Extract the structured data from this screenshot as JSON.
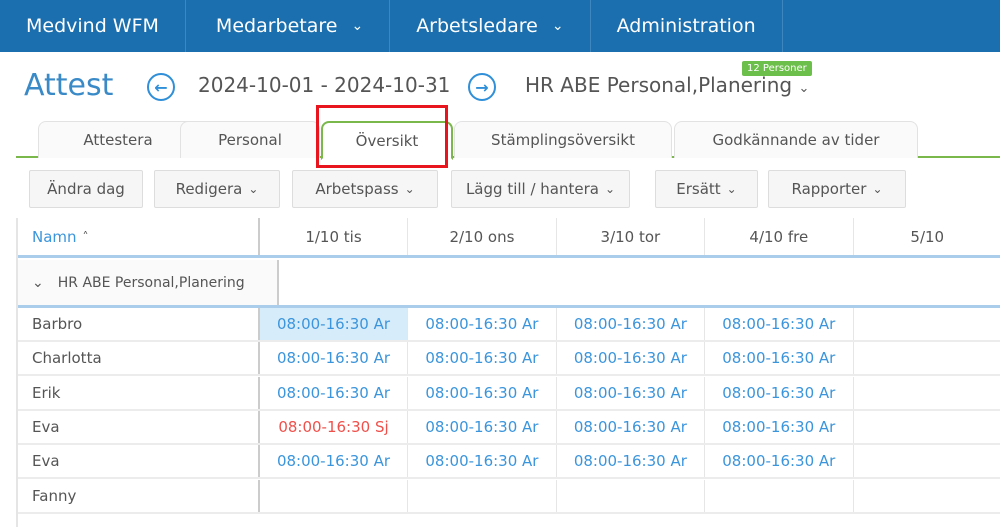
{
  "nav": {
    "items": [
      {
        "label": "Medvind WFM",
        "chevron": false
      },
      {
        "label": "Medarbetare",
        "chevron": true
      },
      {
        "label": "Arbetsledare",
        "chevron": true
      },
      {
        "label": "Administration",
        "chevron": false
      }
    ]
  },
  "header": {
    "title": "Attest",
    "date_range": "2024-10-01 - 2024-10-31",
    "group": "HR ABE Personal,Planering",
    "badge": "12 Personer"
  },
  "tabs": [
    {
      "label": "Attestera"
    },
    {
      "label": "Personal"
    },
    {
      "label": "Översikt",
      "active": true
    },
    {
      "label": "Stämplingsöversikt"
    },
    {
      "label": "Godkännande av tider"
    }
  ],
  "toolbar": [
    {
      "label": "Ändra dag",
      "chevron": false
    },
    {
      "label": "Redigera",
      "chevron": true
    },
    {
      "label": "Arbetspass",
      "chevron": true
    },
    {
      "label": "Lägg till / hantera",
      "chevron": true
    },
    {
      "label": "Ersätt",
      "chevron": true
    },
    {
      "label": "Rapporter",
      "chevron": true
    }
  ],
  "grid": {
    "name_header": "Namn",
    "days": [
      "1/10 tis",
      "2/10 ons",
      "3/10 tor",
      "4/10 fre",
      "5/10"
    ],
    "group_row": "HR ABE Personal,Planering",
    "rows": [
      {
        "name": "Barbro",
        "cells": [
          "08:00-16:30  Ar",
          "08:00-16:30  Ar",
          "08:00-16:30  Ar",
          "08:00-16:30  Ar",
          ""
        ]
      },
      {
        "name": "Charlotta",
        "cells": [
          "08:00-16:30  Ar",
          "08:00-16:30  Ar",
          "08:00-16:30  Ar",
          "08:00-16:30  Ar",
          ""
        ]
      },
      {
        "name": "Erik",
        "cells": [
          "08:00-16:30  Ar",
          "08:00-16:30  Ar",
          "08:00-16:30  Ar",
          "08:00-16:30  Ar",
          ""
        ]
      },
      {
        "name": "Eva",
        "cells": [
          "08:00-16:30  Sj",
          "08:00-16:30  Ar",
          "08:00-16:30  Ar",
          "08:00-16:30  Ar",
          ""
        ]
      },
      {
        "name": "Eva",
        "cells": [
          "08:00-16:30  Ar",
          "08:00-16:30  Ar",
          "08:00-16:30  Ar",
          "08:00-16:30  Ar",
          ""
        ]
      },
      {
        "name": "Fanny",
        "cells": [
          "",
          "",
          "",
          "",
          ""
        ]
      }
    ]
  },
  "colors": {
    "nav": "#1b6fae",
    "accent": "#3b95dc",
    "active_tab": "#7ab84b",
    "sick": "#f0504a",
    "highlight": "#e8141e"
  }
}
